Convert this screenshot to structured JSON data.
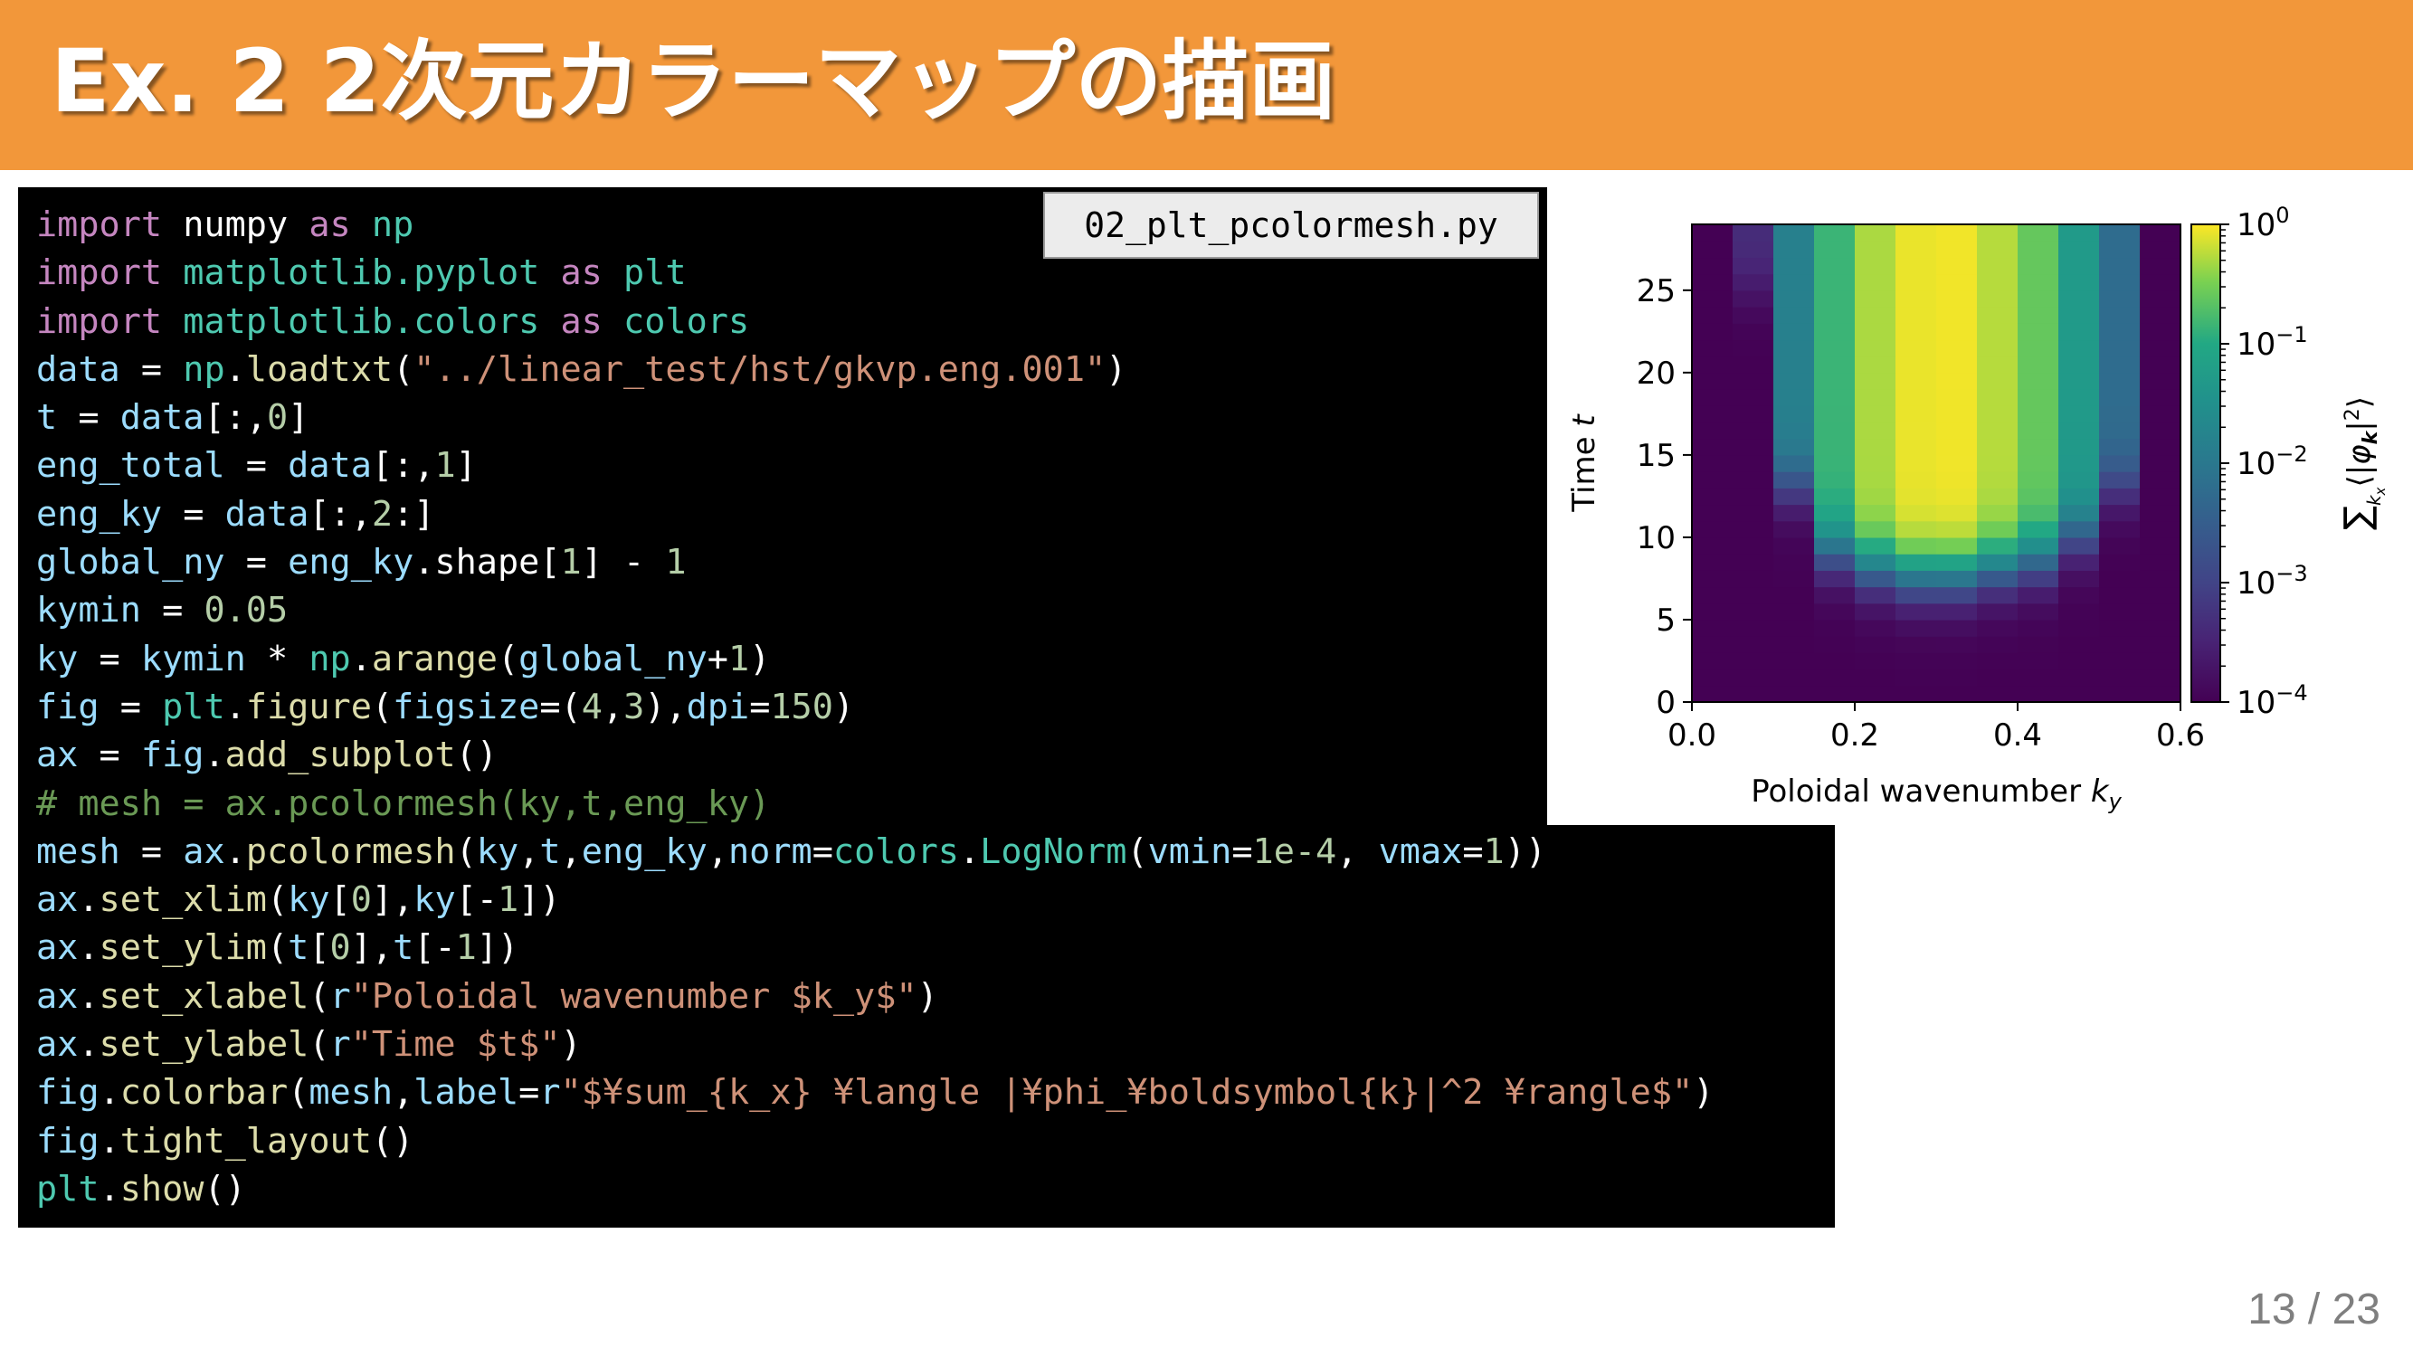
{
  "slide": {
    "title": "Ex. 2 2次元カラーマップの描画",
    "filename": "02_plt_pcolormesh.py",
    "page": "13 / 23"
  },
  "code": [
    [
      [
        "kw",
        "import"
      ],
      [
        "op",
        " numpy "
      ],
      [
        "kw",
        "as"
      ],
      [
        "op",
        " "
      ],
      [
        "mod",
        "np"
      ]
    ],
    [
      [
        "kw",
        "import"
      ],
      [
        "op",
        " "
      ],
      [
        "mod",
        "matplotlib.pyplot"
      ],
      [
        "op",
        " "
      ],
      [
        "kw",
        "as"
      ],
      [
        "op",
        " "
      ],
      [
        "mod",
        "plt"
      ]
    ],
    [
      [
        "kw",
        "import"
      ],
      [
        "op",
        " "
      ],
      [
        "mod",
        "matplotlib.colors"
      ],
      [
        "op",
        " "
      ],
      [
        "kw",
        "as"
      ],
      [
        "op",
        " "
      ],
      [
        "mod",
        "colors"
      ]
    ],
    [
      [
        "var",
        "data"
      ],
      [
        "op",
        " = "
      ],
      [
        "mod",
        "np"
      ],
      [
        "op",
        "."
      ],
      [
        "fn",
        "loadtxt"
      ],
      [
        "op",
        "("
      ],
      [
        "str",
        "\"../linear_test/hst/gkvp.eng.001\""
      ],
      [
        "op",
        ")"
      ]
    ],
    [
      [
        "var",
        "t"
      ],
      [
        "op",
        " = "
      ],
      [
        "var",
        "data"
      ],
      [
        "op",
        "[:,"
      ],
      [
        "num",
        "0"
      ],
      [
        "op",
        "]"
      ]
    ],
    [
      [
        "var",
        "eng_total"
      ],
      [
        "op",
        " = "
      ],
      [
        "var",
        "data"
      ],
      [
        "op",
        "[:,"
      ],
      [
        "num",
        "1"
      ],
      [
        "op",
        "]"
      ]
    ],
    [
      [
        "var",
        "eng_ky"
      ],
      [
        "op",
        " = "
      ],
      [
        "var",
        "data"
      ],
      [
        "op",
        "[:,"
      ],
      [
        "num",
        "2"
      ],
      [
        "op",
        ":]"
      ]
    ],
    [
      [
        "var",
        "global_ny"
      ],
      [
        "op",
        " = "
      ],
      [
        "var",
        "eng_ky"
      ],
      [
        "op",
        ".shape["
      ],
      [
        "num",
        "1"
      ],
      [
        "op",
        "] - "
      ],
      [
        "num",
        "1"
      ]
    ],
    [
      [
        "var",
        "kymin"
      ],
      [
        "op",
        " = "
      ],
      [
        "num",
        "0.05"
      ]
    ],
    [
      [
        "var",
        "ky"
      ],
      [
        "op",
        " = "
      ],
      [
        "var",
        "kymin"
      ],
      [
        "op",
        " * "
      ],
      [
        "mod",
        "np"
      ],
      [
        "op",
        "."
      ],
      [
        "fn",
        "arange"
      ],
      [
        "op",
        "("
      ],
      [
        "var",
        "global_ny"
      ],
      [
        "op",
        "+"
      ],
      [
        "num",
        "1"
      ],
      [
        "op",
        ")"
      ]
    ],
    [
      [
        "var",
        "fig"
      ],
      [
        "op",
        " = "
      ],
      [
        "mod",
        "plt"
      ],
      [
        "op",
        "."
      ],
      [
        "fn",
        "figure"
      ],
      [
        "op",
        "("
      ],
      [
        "var",
        "figsize"
      ],
      [
        "op",
        "=("
      ],
      [
        "num",
        "4"
      ],
      [
        "op",
        ","
      ],
      [
        "num",
        "3"
      ],
      [
        "op",
        "),"
      ],
      [
        "var",
        "dpi"
      ],
      [
        "op",
        "="
      ],
      [
        "num",
        "150"
      ],
      [
        "op",
        ")"
      ]
    ],
    [
      [
        "var",
        "ax"
      ],
      [
        "op",
        " = "
      ],
      [
        "var",
        "fig"
      ],
      [
        "op",
        "."
      ],
      [
        "fn",
        "add_subplot"
      ],
      [
        "op",
        "()"
      ]
    ],
    [
      [
        "cmt",
        "# mesh = ax.pcolormesh(ky,t,eng_ky)"
      ]
    ],
    [
      [
        "var",
        "mesh"
      ],
      [
        "op",
        " = "
      ],
      [
        "var",
        "ax"
      ],
      [
        "op",
        "."
      ],
      [
        "fn",
        "pcolormesh"
      ],
      [
        "op",
        "("
      ],
      [
        "var",
        "ky"
      ],
      [
        "op",
        ","
      ],
      [
        "var",
        "t"
      ],
      [
        "op",
        ","
      ],
      [
        "var",
        "eng_ky"
      ],
      [
        "op",
        ","
      ],
      [
        "var",
        "norm"
      ],
      [
        "op",
        "="
      ],
      [
        "mod",
        "colors"
      ],
      [
        "op",
        "."
      ],
      [
        "mod",
        "LogNorm"
      ],
      [
        "op",
        "("
      ],
      [
        "var",
        "vmin"
      ],
      [
        "op",
        "="
      ],
      [
        "num",
        "1e-4"
      ],
      [
        "op",
        ", "
      ],
      [
        "var",
        "vmax"
      ],
      [
        "op",
        "="
      ],
      [
        "num",
        "1"
      ],
      [
        "op",
        "))"
      ]
    ],
    [
      [
        "var",
        "ax"
      ],
      [
        "op",
        "."
      ],
      [
        "fn",
        "set_xlim"
      ],
      [
        "op",
        "("
      ],
      [
        "var",
        "ky"
      ],
      [
        "op",
        "["
      ],
      [
        "num",
        "0"
      ],
      [
        "op",
        "],"
      ],
      [
        "var",
        "ky"
      ],
      [
        "op",
        "[-"
      ],
      [
        "num",
        "1"
      ],
      [
        "op",
        "])"
      ]
    ],
    [
      [
        "var",
        "ax"
      ],
      [
        "op",
        "."
      ],
      [
        "fn",
        "set_ylim"
      ],
      [
        "op",
        "("
      ],
      [
        "var",
        "t"
      ],
      [
        "op",
        "["
      ],
      [
        "num",
        "0"
      ],
      [
        "op",
        "],"
      ],
      [
        "var",
        "t"
      ],
      [
        "op",
        "[-"
      ],
      [
        "num",
        "1"
      ],
      [
        "op",
        "])"
      ]
    ],
    [
      [
        "var",
        "ax"
      ],
      [
        "op",
        "."
      ],
      [
        "fn",
        "set_xlabel"
      ],
      [
        "op",
        "("
      ],
      [
        "var",
        "r"
      ],
      [
        "str",
        "\"Poloidal wavenumber $k_y$\""
      ],
      [
        "op",
        ")"
      ]
    ],
    [
      [
        "var",
        "ax"
      ],
      [
        "op",
        "."
      ],
      [
        "fn",
        "set_ylabel"
      ],
      [
        "op",
        "("
      ],
      [
        "var",
        "r"
      ],
      [
        "str",
        "\"Time $t$\""
      ],
      [
        "op",
        ")"
      ]
    ],
    [
      [
        "var",
        "fig"
      ],
      [
        "op",
        "."
      ],
      [
        "fn",
        "colorbar"
      ],
      [
        "op",
        "("
      ],
      [
        "var",
        "mesh"
      ],
      [
        "op",
        ","
      ],
      [
        "var",
        "label"
      ],
      [
        "op",
        "="
      ],
      [
        "var",
        "r"
      ],
      [
        "str",
        "\"$¥sum_{k_x} ¥langle |¥phi_¥boldsymbol{k}|^2 ¥rangle$\""
      ],
      [
        "op",
        ")"
      ]
    ],
    [
      [
        "var",
        "fig"
      ],
      [
        "op",
        "."
      ],
      [
        "fn",
        "tight_layout"
      ],
      [
        "op",
        "()"
      ]
    ],
    [
      [
        "mod",
        "plt"
      ],
      [
        "op",
        "."
      ],
      [
        "fn",
        "show"
      ],
      [
        "op",
        "()"
      ]
    ]
  ],
  "chart_data": {
    "type": "heatmap",
    "xlabel": "Poloidal wavenumber k_y",
    "ylabel": "Time t",
    "colorbar_label": "Σ_{k_x} ⟨|φ_k|²⟩",
    "colormap": "viridis",
    "color_scale": "log",
    "xlim": [
      0,
      0.6
    ],
    "ylim": [
      0,
      29
    ],
    "clim": [
      0.0001,
      1
    ],
    "xticks": [
      0,
      0.2,
      0.4,
      0.6
    ],
    "xtick_labels": [
      "0.0",
      "0.2",
      "0.4",
      "0.6"
    ],
    "yticks": [
      0,
      5,
      10,
      15,
      20,
      25
    ],
    "ytick_labels": [
      "0",
      "5",
      "10",
      "15",
      "20",
      "25"
    ],
    "cbar_ticks": [
      {
        "value": 1,
        "base": "10",
        "exp": "0"
      },
      {
        "value": 0.1,
        "base": "10",
        "exp": "−1"
      },
      {
        "value": 0.01,
        "base": "10",
        "exp": "−2"
      },
      {
        "value": 0.001,
        "base": "10",
        "exp": "−3"
      },
      {
        "value": 0.0001,
        "base": "10",
        "exp": "−4"
      }
    ],
    "columns": [
      {
        "ky": 0.0,
        "onset": 99
      },
      {
        "ky": 0.05,
        "onset": 25
      },
      {
        "ky": 0.1,
        "onset": 13
      },
      {
        "ky": 0.15,
        "onset": 9
      },
      {
        "ky": 0.2,
        "onset": 8
      },
      {
        "ky": 0.25,
        "onset": 7.5
      },
      {
        "ky": 0.3,
        "onset": 7.5
      },
      {
        "ky": 0.35,
        "onset": 8
      },
      {
        "ky": 0.4,
        "onset": 8.5
      },
      {
        "ky": 0.45,
        "onset": 10
      },
      {
        "ky": 0.5,
        "onset": 13
      },
      {
        "ky": 0.55,
        "onset": 99
      }
    ],
    "saturation_levels": [
      0.0001,
      0.00045,
      0.015,
      0.14,
      0.5,
      0.85,
      0.9,
      0.55,
      0.25,
      0.05,
      0.006,
      0.0001
    ]
  }
}
